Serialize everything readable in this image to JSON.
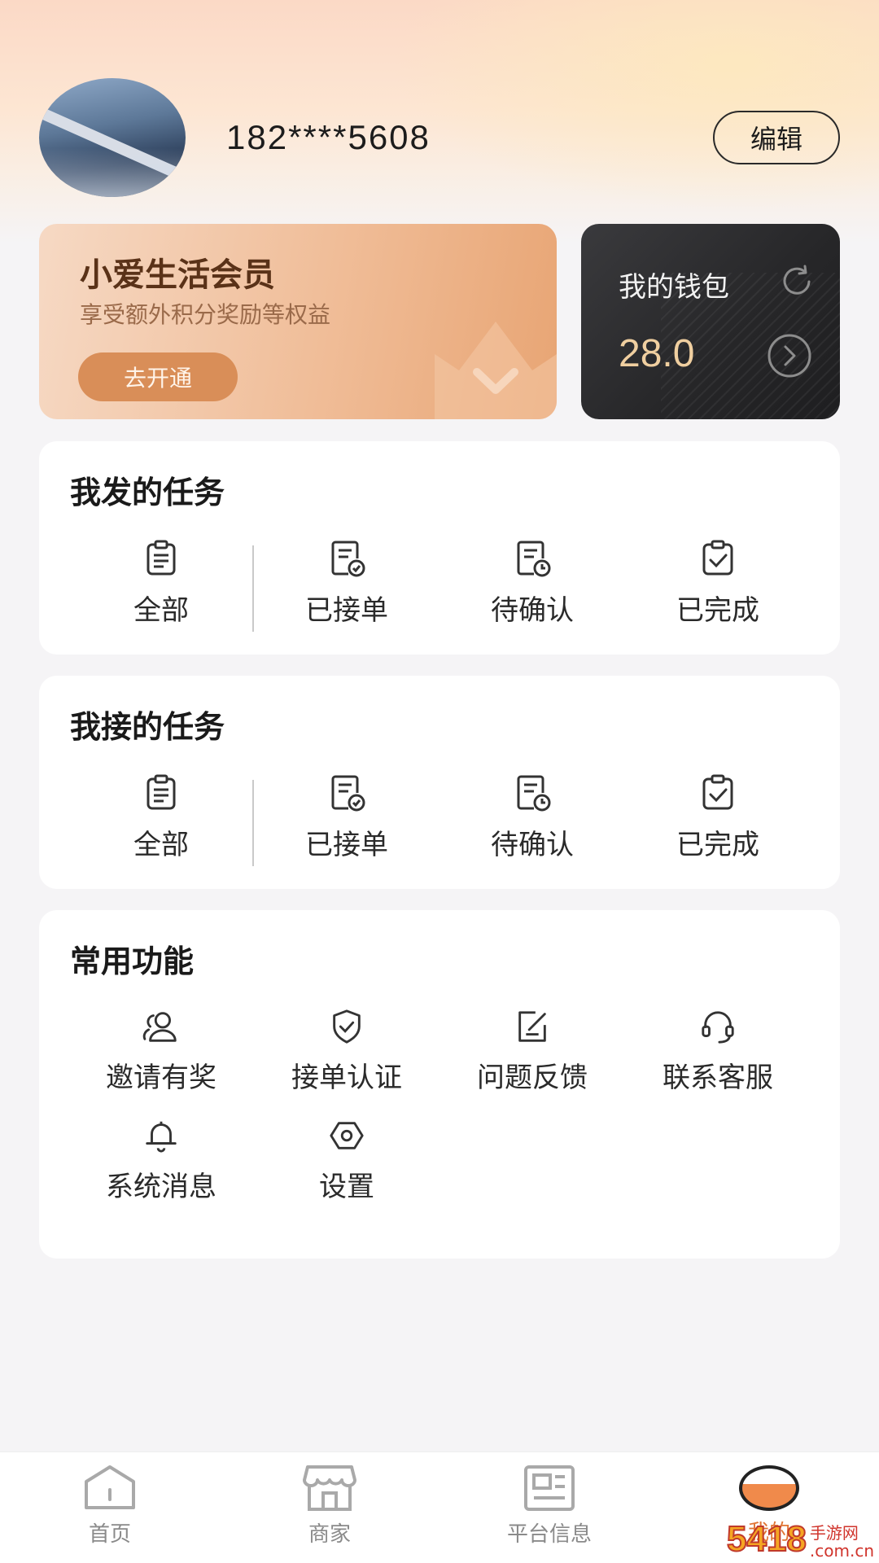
{
  "profile": {
    "phone": "182****5608",
    "edit_label": "编辑"
  },
  "member": {
    "title": "小爱生活会员",
    "subtitle": "享受额外积分奖励等权益",
    "button": "去开通"
  },
  "wallet": {
    "title": "我的钱包",
    "amount": "28.0"
  },
  "published_tasks": {
    "title": "我发的任务",
    "items": [
      {
        "label": "全部",
        "icon": "clipboard-list-icon"
      },
      {
        "label": "已接单",
        "icon": "doc-check-icon"
      },
      {
        "label": "待确认",
        "icon": "doc-clock-icon"
      },
      {
        "label": "已完成",
        "icon": "clipboard-check-icon"
      }
    ]
  },
  "accepted_tasks": {
    "title": "我接的任务",
    "items": [
      {
        "label": "全部",
        "icon": "clipboard-list-icon"
      },
      {
        "label": "已接单",
        "icon": "doc-check-icon"
      },
      {
        "label": "待确认",
        "icon": "doc-clock-icon"
      },
      {
        "label": "已完成",
        "icon": "clipboard-check-icon"
      }
    ]
  },
  "functions": {
    "title": "常用功能",
    "items": [
      {
        "label": "邀请有奖",
        "icon": "users-icon"
      },
      {
        "label": "接单认证",
        "icon": "shield-check-icon"
      },
      {
        "label": "问题反馈",
        "icon": "edit-icon"
      },
      {
        "label": "联系客服",
        "icon": "headset-icon"
      },
      {
        "label": "系统消息",
        "icon": "bell-icon"
      },
      {
        "label": "设置",
        "icon": "settings-icon"
      }
    ]
  },
  "tabbar": {
    "items": [
      {
        "label": "首页",
        "icon": "home-icon"
      },
      {
        "label": "商家",
        "icon": "store-icon"
      },
      {
        "label": "平台信息",
        "icon": "news-icon"
      },
      {
        "label": "我的",
        "icon": "me-icon",
        "active": true
      }
    ]
  },
  "watermark": {
    "number": "5418",
    "text": "手游网",
    "domain": ".com.cn"
  },
  "colors": {
    "accent": "#e07636",
    "wallet_amount": "#f0cfa0",
    "member_button": "#d98e58"
  }
}
